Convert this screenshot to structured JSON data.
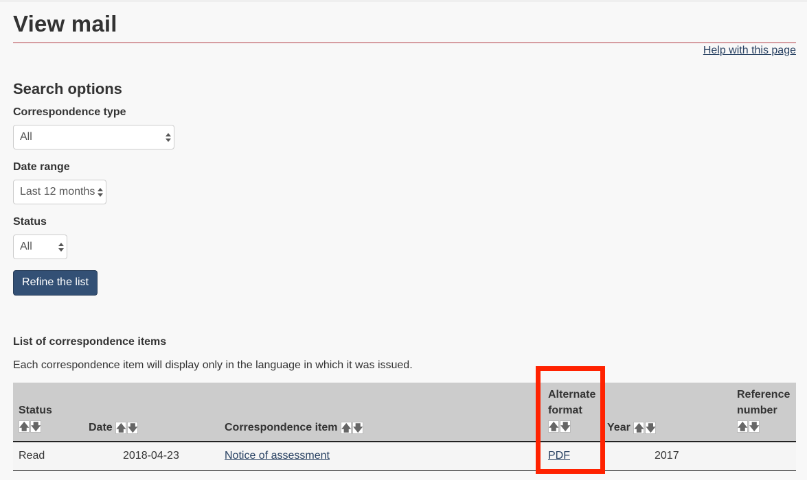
{
  "page": {
    "title": "View mail",
    "help_link": "Help with this page"
  },
  "search": {
    "heading": "Search options",
    "correspondence_type": {
      "label": "Correspondence type",
      "value": "All"
    },
    "date_range": {
      "label": "Date range",
      "value": "Last 12 months"
    },
    "status": {
      "label": "Status",
      "value": "All"
    },
    "refine_button": "Refine the list"
  },
  "list": {
    "heading": "List of correspondence items",
    "note": "Each correspondence item will display only in the language in which it was issued.",
    "columns": [
      {
        "line1": "Status",
        "line2": ""
      },
      {
        "line1": "Date",
        "line2": ""
      },
      {
        "line1": "Correspondence item",
        "line2": ""
      },
      {
        "line1": "Alternate",
        "line2": "format"
      },
      {
        "line1": "Year",
        "line2": ""
      },
      {
        "line1": "Reference",
        "line2": "number"
      }
    ],
    "sort_icons": {
      "up": "arrow-up-icon",
      "down": "arrow-down-icon"
    },
    "rows": [
      {
        "status": "Read",
        "date": "2018-04-23",
        "item": "Notice of assessment",
        "format": "PDF",
        "year": "2017",
        "reference": ""
      }
    ]
  },
  "annotation": {
    "highlight_color": "#ff2200"
  }
}
